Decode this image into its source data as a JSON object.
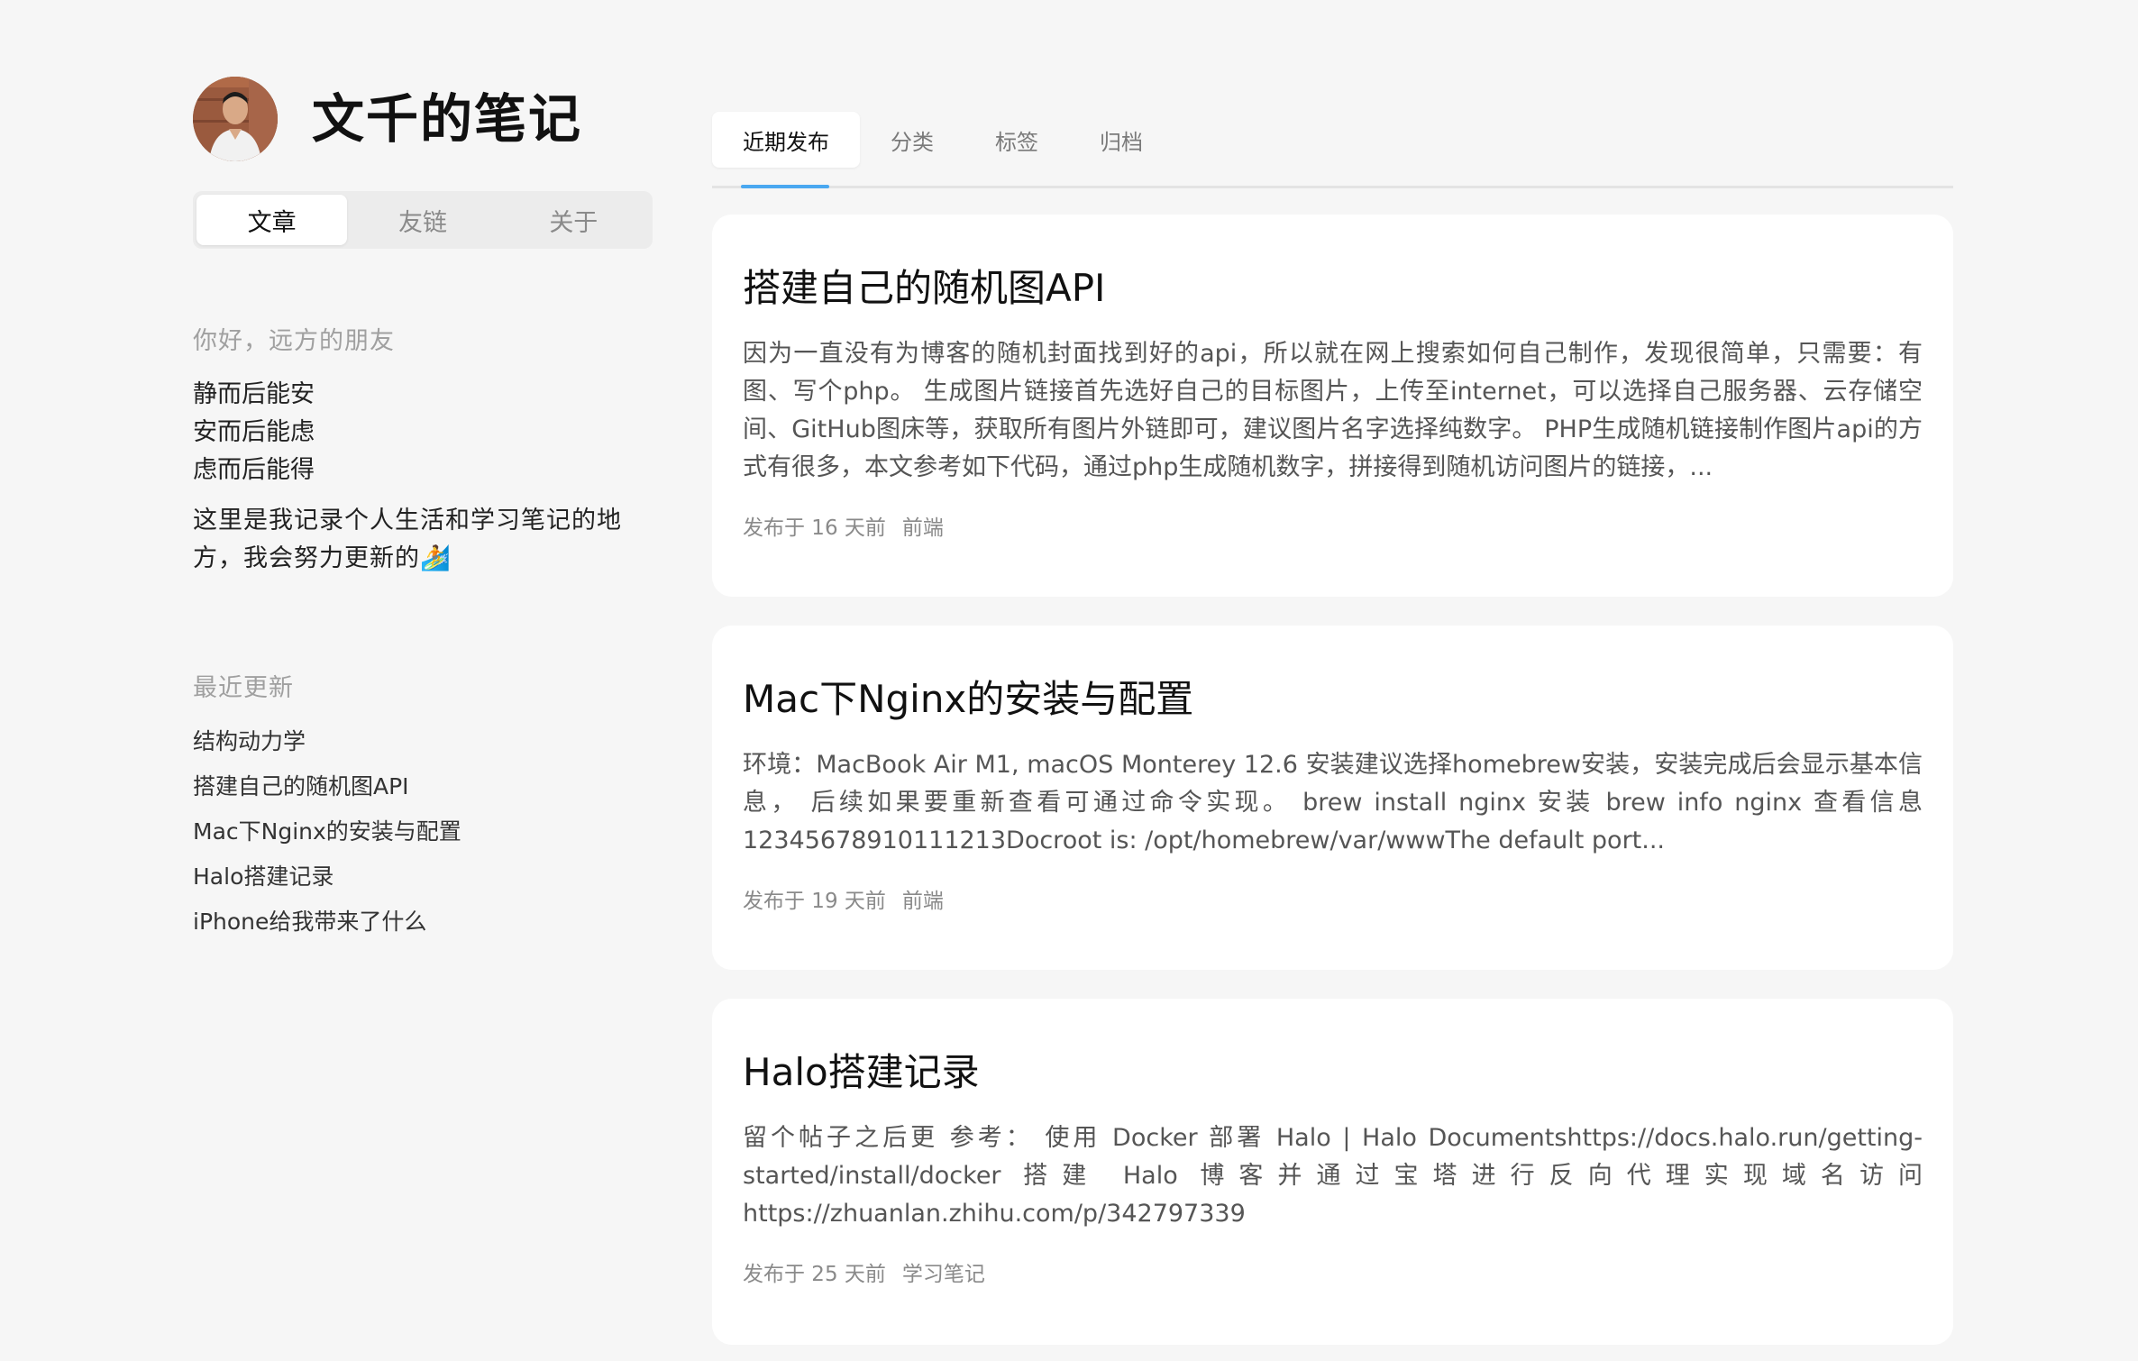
{
  "site": {
    "title": "文千的笔记"
  },
  "sidebar": {
    "nav": [
      {
        "label": "文章",
        "active": true
      },
      {
        "label": "友链",
        "active": false
      },
      {
        "label": "关于",
        "active": false
      }
    ],
    "greeting_label": "你好，远方的朋友",
    "motto": [
      "静而后能安",
      "安而后能虑",
      "虑而后能得"
    ],
    "intro": "这里是我记录个人生活和学习笔记的地方，我会努力更新的🏄",
    "recent_label": "最近更新",
    "recent_posts": [
      "结构动力学",
      "搭建自己的随机图API",
      "Mac下Nginx的安装与配置",
      "Halo搭建记录",
      "iPhone给我带来了什么"
    ]
  },
  "main": {
    "tabs": [
      {
        "label": "近期发布",
        "active": true
      },
      {
        "label": "分类",
        "active": false
      },
      {
        "label": "标签",
        "active": false
      },
      {
        "label": "归档",
        "active": false
      }
    ],
    "posts": [
      {
        "title": "搭建自己的随机图API",
        "excerpt": "因为一直没有为博客的随机封面找到好的api，所以就在网上搜索如何自己制作，发现很简单，只需要：有图、写个php。 生成图片链接首先选好自己的目标图片，上传至internet，可以选择自己服务器、云存储空间、GitHub图床等，获取所有图片外链即可，建议图片名字选择纯数字。 PHP生成随机链接制作图片api的方式有很多，本文参考如下代码，通过php生成随机数字，拼接得到随机访问图片的链接，...",
        "date": "发布于 16 天前",
        "category": "前端"
      },
      {
        "title": "Mac下Nginx的安装与配置",
        "excerpt": "环境：MacBook Air M1, macOS Monterey 12.6 安装建议选择homebrew安装，安装完成后会显示基本信息， 后续如果要重新查看可通过命令实现。 brew install nginx 安装 brew info nginx 查看信息 12345678910111213Docroot is: /opt/homebrew/var/wwwThe default port...",
        "date": "发布于 19 天前",
        "category": "前端"
      },
      {
        "title": "Halo搭建记录",
        "excerpt": "留个帖子之后更 参考： 使用 Docker 部署 Halo | Halo Documentshttps://docs.halo.run/getting-started/install/docker 搭建 Halo 博客并通过宝塔进行反向代理实现域名访问 https://zhuanlan.zhihu.com/p/342797339",
        "date": "发布于 25 天前",
        "category": "学习笔记"
      }
    ]
  },
  "colors": {
    "background": "#f6f6f6",
    "card": "#ffffff",
    "accent": "#4aa8f0"
  }
}
